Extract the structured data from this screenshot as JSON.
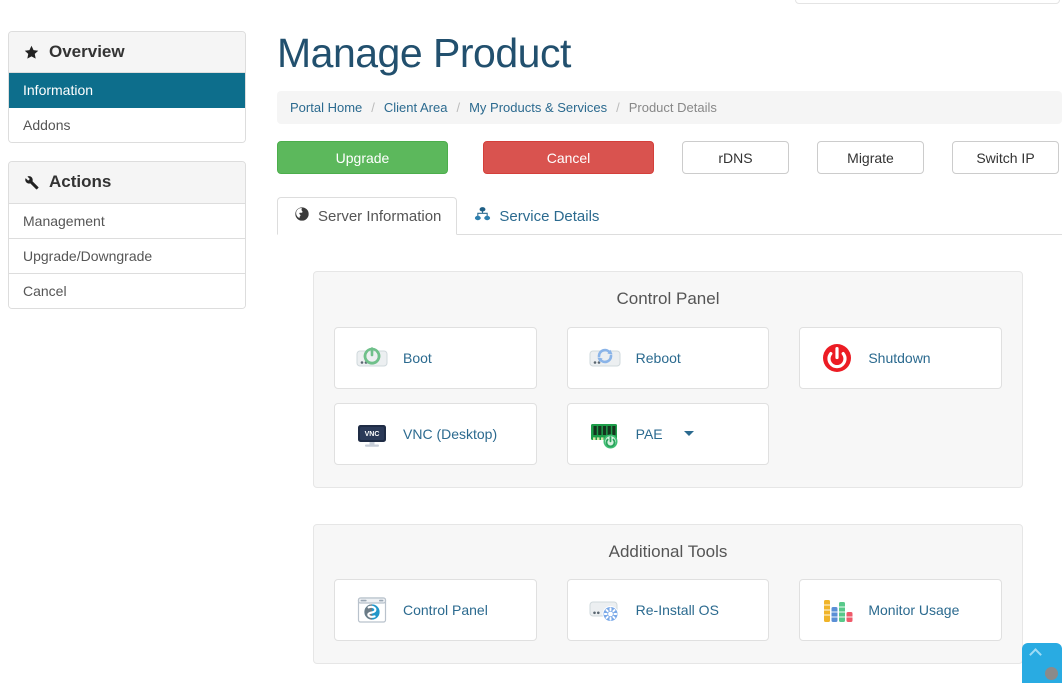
{
  "header": {
    "title": "Manage Product"
  },
  "breadcrumb": {
    "items": [
      {
        "label": "Portal Home",
        "current": false
      },
      {
        "label": "Client Area",
        "current": false
      },
      {
        "label": "My Products & Services",
        "current": false
      },
      {
        "label": "Product Details",
        "current": true
      }
    ],
    "separator": "/"
  },
  "action_buttons": [
    {
      "label": "Upgrade",
      "style": "success",
      "color": "#5cb85c"
    },
    {
      "label": "Cancel",
      "style": "danger",
      "color": "#d9534f"
    },
    {
      "label": "rDNS",
      "style": "default",
      "color": "#ffffff"
    },
    {
      "label": "Migrate",
      "style": "default",
      "color": "#ffffff"
    },
    {
      "label": "Switch IP",
      "style": "default",
      "color": "#ffffff"
    }
  ],
  "sidebar": {
    "panels": [
      {
        "title": "Overview",
        "icon": "star-icon",
        "items": [
          {
            "label": "Information",
            "active": true
          },
          {
            "label": "Addons",
            "active": false
          }
        ]
      },
      {
        "title": "Actions",
        "icon": "wrench-icon",
        "items": [
          {
            "label": "Management",
            "active": false
          },
          {
            "label": "Upgrade/Downgrade",
            "active": false
          },
          {
            "label": "Cancel",
            "active": false
          }
        ]
      }
    ]
  },
  "tabs": [
    {
      "label": "Server Information",
      "icon": "globe-icon",
      "active": true
    },
    {
      "label": "Service Details",
      "icon": "sitemap-icon",
      "active": false
    }
  ],
  "sections": [
    {
      "title": "Control Panel",
      "tiles": [
        {
          "label": "Boot",
          "icon": "server-power-green-icon",
          "dropdown": false
        },
        {
          "label": "Reboot",
          "icon": "server-refresh-icon",
          "dropdown": false
        },
        {
          "label": "Shutdown",
          "icon": "power-red-icon",
          "dropdown": false
        },
        {
          "label": "VNC (Desktop)",
          "icon": "vnc-monitor-icon",
          "dropdown": false
        },
        {
          "label": "PAE",
          "icon": "memory-power-icon",
          "dropdown": true
        }
      ]
    },
    {
      "title": "Additional Tools",
      "tiles": [
        {
          "label": "Control Panel",
          "icon": "browser-swirl-icon",
          "dropdown": false
        },
        {
          "label": "Re-Install OS",
          "icon": "server-gear-icon",
          "dropdown": false
        },
        {
          "label": "Monitor Usage",
          "icon": "bar-chart-icon",
          "dropdown": false
        }
      ]
    }
  ],
  "colors": {
    "accent_link": "#2b6a8f",
    "sidebar_active": "#0d6e8c",
    "title": "#22506e",
    "success": "#5cb85c",
    "danger": "#d9534f",
    "chat_widget": "#29abe2"
  },
  "chat_widget": {
    "name": "chat-launcher"
  }
}
